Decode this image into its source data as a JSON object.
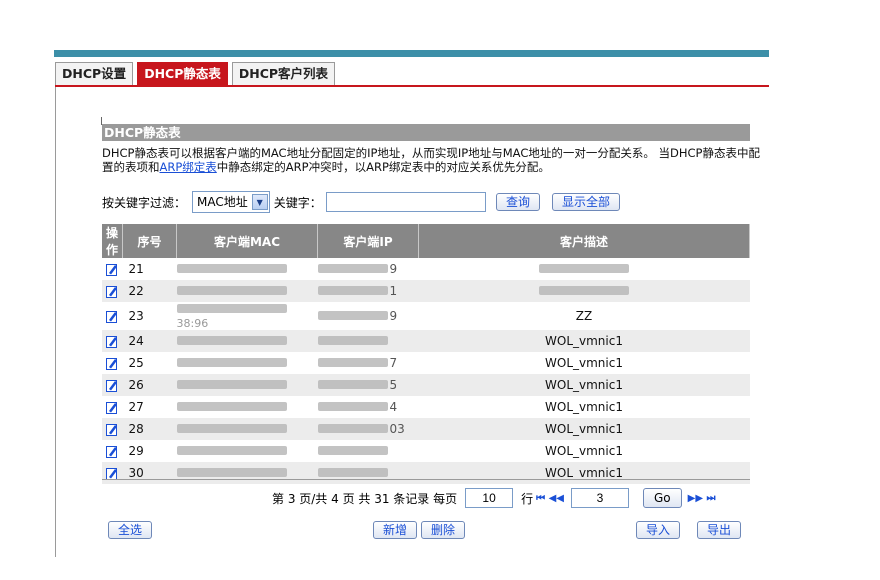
{
  "tabs": [
    {
      "label": "DHCP设置",
      "active": false
    },
    {
      "label": "DHCP静态表",
      "active": true
    },
    {
      "label": "DHCP客户列表",
      "active": false
    }
  ],
  "section": {
    "title": "DHCP静态表"
  },
  "description": {
    "text_before_link": "DHCP静态表可以根据客户端的MAC地址分配固定的IP地址，从而实现IP地址与MAC地址的一对一分配关系。 当DHCP静态表中配置的表项和",
    "link_text": "ARP绑定表",
    "text_after_link": "中静态绑定的ARP冲突时，以ARP绑定表中的对应关系优先分配。"
  },
  "filter": {
    "label": "按关键字过滤：",
    "select_value": "MAC地址",
    "keyword_label": "关键字：",
    "keyword_value": "",
    "query_label": "查询",
    "show_all_label": "显示全部"
  },
  "table": {
    "headers": [
      "操作",
      "序号",
      "客户端MAC",
      "客户端IP",
      "客户描述"
    ],
    "rows": [
      {
        "no": "21",
        "mac_tail": "",
        "ip_tail": "9",
        "desc": ""
      },
      {
        "no": "22",
        "mac_tail": "",
        "ip_tail": "1",
        "desc": ""
      },
      {
        "no": "23",
        "mac_tail": "38:96",
        "ip_tail": "9",
        "desc": "ZZ"
      },
      {
        "no": "24",
        "mac_tail": "",
        "ip_tail": "",
        "desc": "WOL_vmnic1"
      },
      {
        "no": "25",
        "mac_tail": "",
        "ip_tail": "7",
        "desc": "WOL_vmnic1"
      },
      {
        "no": "26",
        "mac_tail": "",
        "ip_tail": "5",
        "desc": "WOL_vmnic1"
      },
      {
        "no": "27",
        "mac_tail": "",
        "ip_tail": "4",
        "desc": "WOL_vmnic1"
      },
      {
        "no": "28",
        "mac_tail": "",
        "ip_tail": "03",
        "desc": "WOL_vmnic1"
      },
      {
        "no": "29",
        "mac_tail": "",
        "ip_tail": "",
        "desc": "WOL_vmnic1"
      },
      {
        "no": "30",
        "mac_tail": "",
        "ip_tail": "",
        "desc": "WOL_vmnic1"
      }
    ]
  },
  "pager": {
    "summary": "第 3 页/共 4 页 共 31 条记录 每页",
    "per_page": "10",
    "rows_label": "行",
    "first_prev": "⏮ ◀◀",
    "page_value": "3",
    "go_label": "Go",
    "next_last": "▶▶ ⏭"
  },
  "buttons": {
    "select_all": "全选",
    "add": "新增",
    "delete": "删除",
    "import": "导入",
    "export": "导出"
  },
  "colors": {
    "accent_bar": "#3c8fa8",
    "active_tab": "#c7161d",
    "header_gray": "#878787",
    "link": "#1a4fd6"
  }
}
